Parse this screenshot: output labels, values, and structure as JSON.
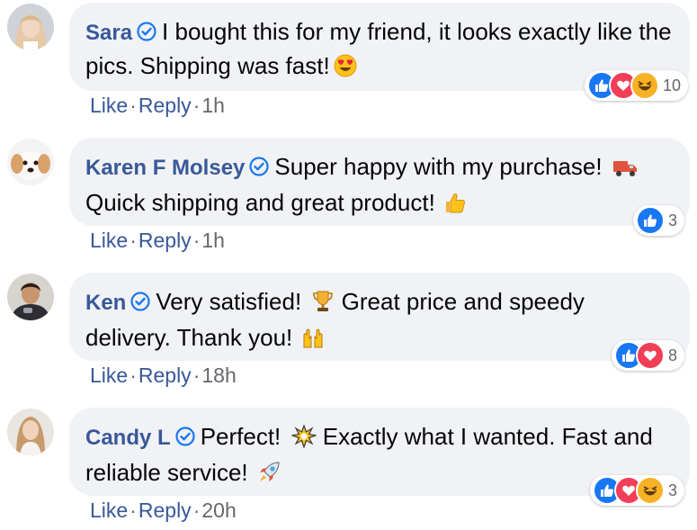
{
  "comments": [
    {
      "author": "Sara",
      "text": "I bought this for my friend, it looks exactly like the pics. Shipping was fast!",
      "reaction_count": "10",
      "like": "Like",
      "reply": "Reply",
      "time": "1h"
    },
    {
      "author": "Karen F Molsey",
      "text": "Super happy with my purchase! ",
      "text2": "Quick shipping and great product!",
      "reaction_count": "3",
      "like": "Like",
      "reply": "Reply",
      "time": "1h"
    },
    {
      "author": "Ken",
      "text": "Very satisfied! ",
      "text2": " Great price and speedy delivery. Thank you!",
      "reaction_count": "8",
      "like": "Like",
      "reply": "Reply",
      "time": "18h"
    },
    {
      "author": "Candy L",
      "text": "Perfect! ",
      "text2": " Exactly what I wanted. Fast and reliable service!",
      "reaction_count": "3",
      "like": "Like",
      "reply": "Reply",
      "time": "20h"
    }
  ],
  "separator": "·",
  "colors": {
    "name": "#385898",
    "like_blue": "#1877f2",
    "love_red": "#f33e58",
    "haha_yellow": "#f7b125",
    "bubble_bg": "#f0f2f5"
  },
  "icons": {
    "verified": "verified-badge-icon",
    "like": "like-reaction-icon",
    "love": "love-reaction-icon",
    "haha": "haha-reaction-icon"
  }
}
